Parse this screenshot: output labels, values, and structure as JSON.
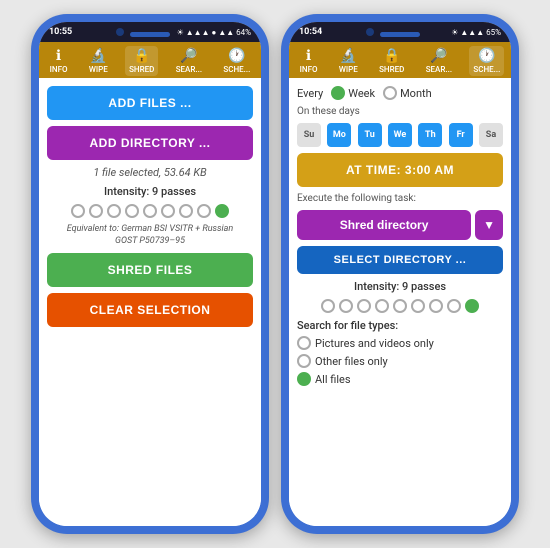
{
  "phone1": {
    "status": {
      "time": "10:55",
      "icons": "● ▲▲ 64%"
    },
    "nav": {
      "items": [
        {
          "id": "info",
          "icon": "ℹ",
          "label": "INFO"
        },
        {
          "id": "wipe",
          "icon": "🔍",
          "label": "WIPE"
        },
        {
          "id": "shred",
          "icon": "🔒",
          "label": "SHRED",
          "active": true
        },
        {
          "id": "search",
          "icon": "🔎",
          "label": "SEAR..."
        },
        {
          "id": "schedule",
          "icon": "🕐",
          "label": "SCHE..."
        }
      ]
    },
    "content": {
      "add_files_btn": "ADD FILES ...",
      "add_dir_btn": "ADD DIRECTORY ...",
      "file_info": "1 file selected, 53.64 KB",
      "intensity_label": "Intensity: 9 passes",
      "equiv_text": "Equivalent to: German BSI VSITR + Russian\nGOST P50739–95",
      "shred_btn": "SHRED FILES",
      "clear_btn": "CLEAR SELECTION"
    }
  },
  "phone2": {
    "status": {
      "time": "10:54",
      "icons": "● ▲▲ 65%"
    },
    "nav": {
      "items": [
        {
          "id": "info",
          "icon": "ℹ",
          "label": "INFO"
        },
        {
          "id": "wipe",
          "icon": "🔍",
          "label": "WIPE"
        },
        {
          "id": "shred",
          "icon": "🔒",
          "label": "SHRED"
        },
        {
          "id": "search",
          "icon": "🔎",
          "label": "SEAR..."
        },
        {
          "id": "schedule",
          "icon": "🕐",
          "label": "SCHE...",
          "active": true
        }
      ]
    },
    "content": {
      "every_label": "Every",
      "week_label": "Week",
      "month_label": "Month",
      "on_these_days": "On these days",
      "days": [
        "Su",
        "Mo",
        "Tu",
        "We",
        "Th",
        "Fr",
        "Sa"
      ],
      "active_days": [
        "Mo",
        "Tu",
        "We",
        "Th",
        "Fr"
      ],
      "at_time_btn": "AT TIME: 3:00 AM",
      "execute_label": "Execute the following task:",
      "task_label": "Shred directory",
      "select_dir_btn": "SELECT DIRECTORY ...",
      "intensity_label": "Intensity: 9 passes",
      "search_for_label": "Search for file types:",
      "option1": "Pictures and videos only",
      "option2": "Other files only",
      "option3": "All files"
    }
  }
}
